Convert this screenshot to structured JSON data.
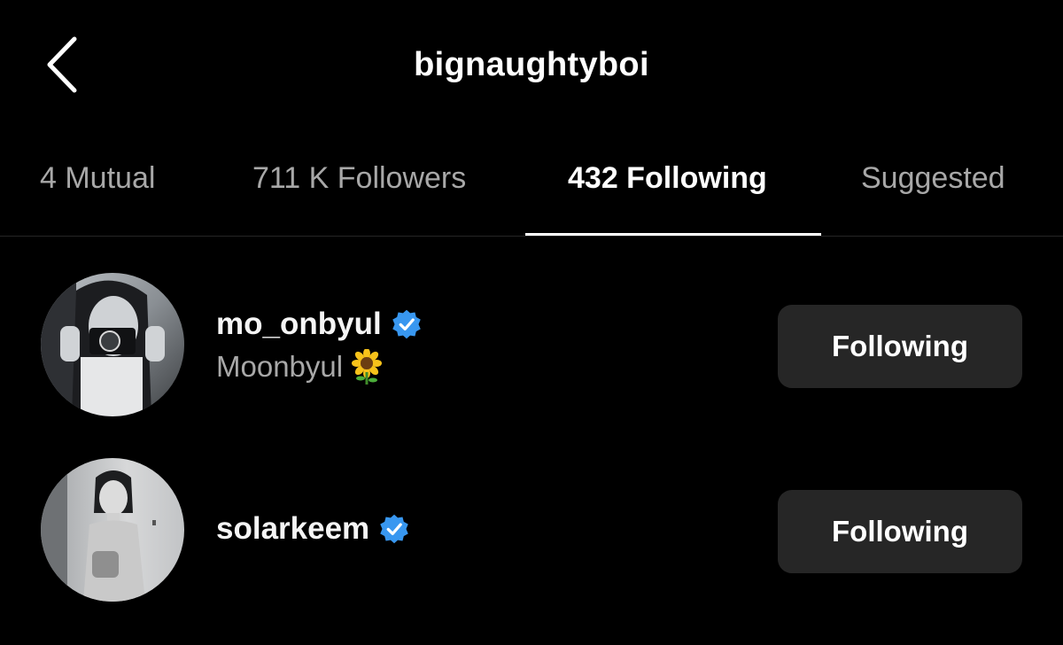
{
  "header": {
    "title": "bignaughtyboi",
    "back_icon": "chevron-left-icon"
  },
  "tabs": [
    {
      "label": "4 Mutual",
      "active": false
    },
    {
      "label": "711 K Followers",
      "active": false
    },
    {
      "label": "432 Following",
      "active": true
    },
    {
      "label": "Suggested",
      "active": false
    }
  ],
  "users": [
    {
      "username": "mo_onbyul",
      "verified": true,
      "full_name": "Moonbyul",
      "name_emoji": "sunflower-icon",
      "button_label": "Following"
    },
    {
      "username": "solarkeem",
      "verified": true,
      "full_name": "",
      "button_label": "Following"
    }
  ],
  "colors": {
    "background": "#000000",
    "verified_blue": "#3897f0",
    "button_bg": "#262626",
    "muted_text": "#a8a8a8"
  }
}
